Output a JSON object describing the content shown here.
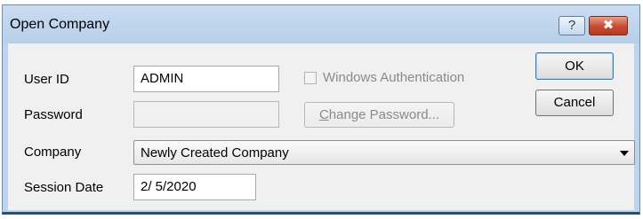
{
  "window": {
    "title": "Open Company",
    "help_glyph": "?",
    "close_glyph": "✖"
  },
  "form": {
    "user_id_label": "User ID",
    "user_id_value": "ADMIN",
    "password_label": "Password",
    "password_value": "",
    "windows_auth_label": "Windows Authentication",
    "windows_auth_checked": false,
    "change_password_prefix": "",
    "change_password_mnemonic": "C",
    "change_password_rest": "hange Password...",
    "company_label": "Company",
    "company_value": "Newly Created Company",
    "session_date_label": "Session Date",
    "session_date_value": "2/ 5/2020"
  },
  "buttons": {
    "ok_label": "OK",
    "cancel_label": "Cancel"
  },
  "icons": {
    "help": "help-icon",
    "close": "close-icon",
    "dropdown": "chevron-down-icon"
  },
  "colors": {
    "title_bar": "#bcd4ec",
    "close_button": "#c74a32",
    "client_background": "#f0f0f0",
    "default_button_border": "#3c7fb1"
  }
}
